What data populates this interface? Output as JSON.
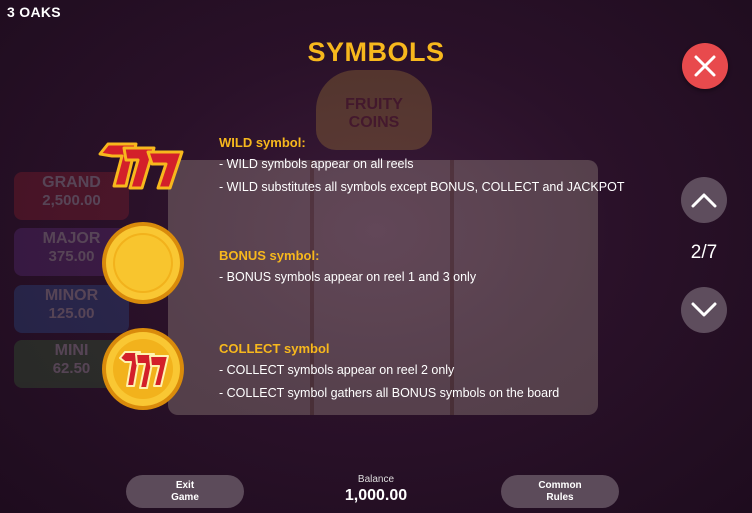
{
  "brand": "3 OAKS",
  "title": "SYMBOLS",
  "page_indicator": "2/7",
  "background": {
    "logo_lines": [
      "FRUITY",
      "COINS"
    ],
    "jackpots": [
      {
        "label": "GRAND",
        "value": "2,500.00",
        "color": "#c0282f"
      },
      {
        "label": "MAJOR",
        "value": "375.00",
        "color": "#7a3ea8"
      },
      {
        "label": "MINOR",
        "value": "125.00",
        "color": "#2f6fc4"
      },
      {
        "label": "MINI",
        "value": "62.50",
        "color": "#3e8f3a"
      }
    ]
  },
  "sections": [
    {
      "title": "WILD symbol:",
      "icon": "sevens-wild-icon",
      "lines": [
        "- WILD symbols appear on all reels",
        "- WILD substitutes all symbols except BONUS, COLLECT and JACKPOT"
      ]
    },
    {
      "title": "BONUS symbol:",
      "icon": "gold-coin-icon",
      "lines": [
        "- BONUS symbols appear on reel 1 and 3 only"
      ]
    },
    {
      "title": "COLLECT symbol",
      "icon": "gold-coin-sevens-icon",
      "lines": [
        "- COLLECT symbols appear on reel 2 only",
        "- COLLECT symbol gathers all BONUS symbols on the board"
      ]
    }
  ],
  "footer": {
    "exit_line1": "Exit",
    "exit_line2": "Game",
    "balance_label": "Balance",
    "balance_value": "1,000.00",
    "rules_line1": "Common",
    "rules_line2": "Rules"
  },
  "colors": {
    "accent": "#f7b81d",
    "close": "#e84a4d",
    "button": "#5c4b5a"
  }
}
